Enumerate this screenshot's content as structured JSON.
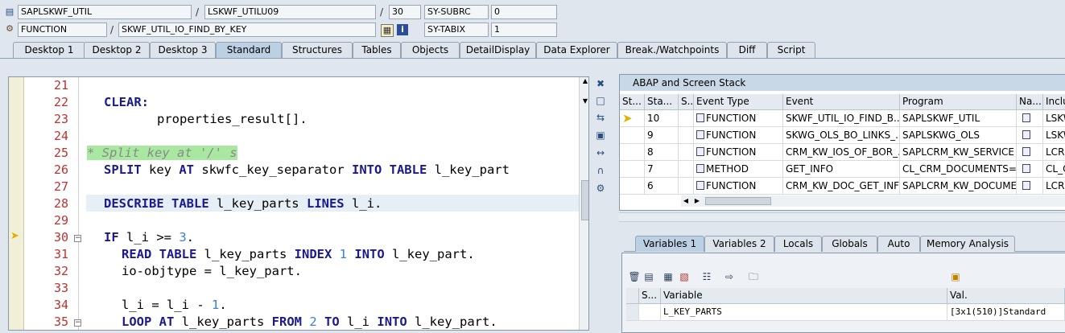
{
  "header": {
    "row1": {
      "program": "SAPLSKWF_UTIL",
      "include": "LSKWF_UTILU09",
      "line": "30",
      "sysfield": "SY-SUBRC",
      "sysvalue": "0"
    },
    "row2": {
      "type": "FUNCTION",
      "name": "SKWF_UTIL_IO_FIND_BY_KEY",
      "sysfield": "SY-TABIX",
      "sysvalue": "1"
    },
    "separator": "/"
  },
  "tabs": [
    "Desktop 1",
    "Desktop 2",
    "Desktop 3",
    "Standard",
    "Structures",
    "Tables",
    "Objects",
    "DetailDisplay",
    "Data Explorer",
    "Break./Watchpoints",
    "Diff",
    "Script"
  ],
  "active_tab": "Standard",
  "editor": {
    "lines": [
      {
        "n": "21"
      },
      {
        "n": "22"
      },
      {
        "n": "23"
      },
      {
        "n": "24"
      },
      {
        "n": "25"
      },
      {
        "n": "26"
      },
      {
        "n": "27"
      },
      {
        "n": "28"
      },
      {
        "n": "29"
      },
      {
        "n": "30"
      },
      {
        "n": "31"
      },
      {
        "n": "32"
      },
      {
        "n": "33"
      },
      {
        "n": "34"
      },
      {
        "n": "35"
      }
    ],
    "tokens": {
      "clear": "CLEAR:",
      "props": "properties_result[].",
      "comment": "* Split key at '/' s",
      "split_kw": "SPLIT",
      "split_key": " key ",
      "at_kw": "AT",
      "sep": " skwfc_key_separator ",
      "into_kw": "INTO",
      "table_kw": " TABLE",
      "split_rest": " l_key_part",
      "describe_kw": "DESCRIBE TABLE",
      "describe_mid": " l_key_parts ",
      "lines_kw": "LINES",
      "describe_end": " l_i.",
      "if_kw": "IF",
      "if_mid": " l_i >= ",
      "num3": "3",
      "dot": ".",
      "read_kw": "READ TABLE",
      "read_mid": " l_key_parts ",
      "index_kw": "INDEX",
      "num1": "1",
      "into2": "INTO",
      "read_end": " l_key_part.",
      "ioobj": "io-objtype = l_key_part.",
      "li": "l_i = l_i - ",
      "loop_kw": "LOOP AT",
      "loop_mid": " l_key_parts ",
      "from_kw": "FROM",
      "num2": "2",
      "to_kw": "TO",
      "loop_mid2": " l_i ",
      "into3": "INTO",
      "loop_end": " l_key_part."
    }
  },
  "stack": {
    "title": "ABAP and Screen Stack",
    "columns": [
      "St...",
      "Sta...",
      "S...",
      "Event Type",
      "Event",
      "Program",
      "Na...",
      "Inclu"
    ],
    "rows": [
      {
        "level": "10",
        "etype": "FUNCTION",
        "event": "SKWF_UTIL_IO_FIND_B...",
        "program": "SAPLSKWF_UTIL",
        "incl": "LSKW",
        "current": true
      },
      {
        "level": "9",
        "etype": "FUNCTION",
        "event": "SKWG_OLS_BO_LINKS_...",
        "program": "SAPLSKWG_OLS",
        "incl": "LSKW",
        "current": false
      },
      {
        "level": "8",
        "etype": "FUNCTION",
        "event": "CRM_KW_IOS_OF_BOR_...",
        "program": "SAPLCRM_KW_SERVICE",
        "incl": "LCRM",
        "current": false
      },
      {
        "level": "7",
        "etype": "METHOD",
        "event": "GET_INFO",
        "program": "CL_CRM_DOCUMENTS=...",
        "incl": "CL_C",
        "current": false
      },
      {
        "level": "6",
        "etype": "FUNCTION",
        "event": "CRM_KW_DOC_GET_INFO",
        "program": "SAPLCRM_KW_DOCUME...",
        "incl": "LCRM",
        "current": false
      }
    ]
  },
  "var_tabs": [
    "Variables 1",
    "Variables 2",
    "Locals",
    "Globals",
    "Auto",
    "Memory Analysis"
  ],
  "variables": {
    "columns": [
      "S...",
      "Variable",
      "Val."
    ],
    "rows": [
      {
        "variable": "L_KEY_PARTS",
        "value": "[3x1(510)]Standard"
      }
    ]
  }
}
